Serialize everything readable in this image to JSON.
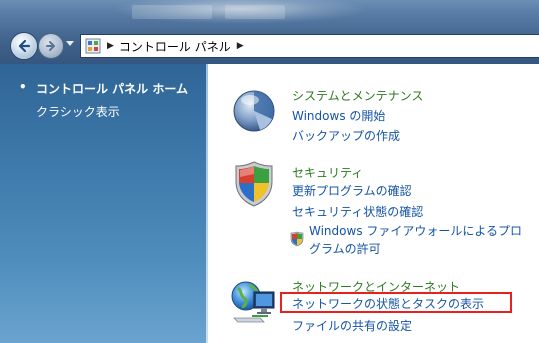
{
  "colors": {
    "category_title": "#2c7a1f",
    "link": "#1554a6",
    "highlight_border": "#e8201e",
    "left_pane_top": "#2f6596",
    "left_pane_bottom": "#6aa3cf"
  },
  "toolbar": {
    "back_icon": "back-arrow-icon",
    "forward_icon": "forward-arrow-icon",
    "recent_pages_icon": "chevron-down-icon",
    "address": {
      "location_icon": "control-panel-icon",
      "breadcrumb": [
        "コントロール パネル"
      ]
    }
  },
  "sidebar": {
    "home_label": "コントロール パネル ホーム",
    "classic_label": "クラシック表示"
  },
  "categories": [
    {
      "icon": "system-maintenance-icon",
      "title": "システムとメンテナンス",
      "links": [
        "Windows の開始",
        "バックアップの作成"
      ]
    },
    {
      "icon": "security-shield-icon",
      "title": "セキュリティ",
      "links": [
        "更新プログラムの確認",
        "セキュリティ状態の確認"
      ],
      "firewall_link_line1": "Windows ファイアウォールによるプロ",
      "firewall_link_line2": "グラムの許可"
    },
    {
      "icon": "network-internet-icon",
      "title": "ネットワークとインターネット",
      "links": [
        "ネットワークの状態とタスクの表示",
        "ファイルの共有の設定"
      ]
    }
  ]
}
